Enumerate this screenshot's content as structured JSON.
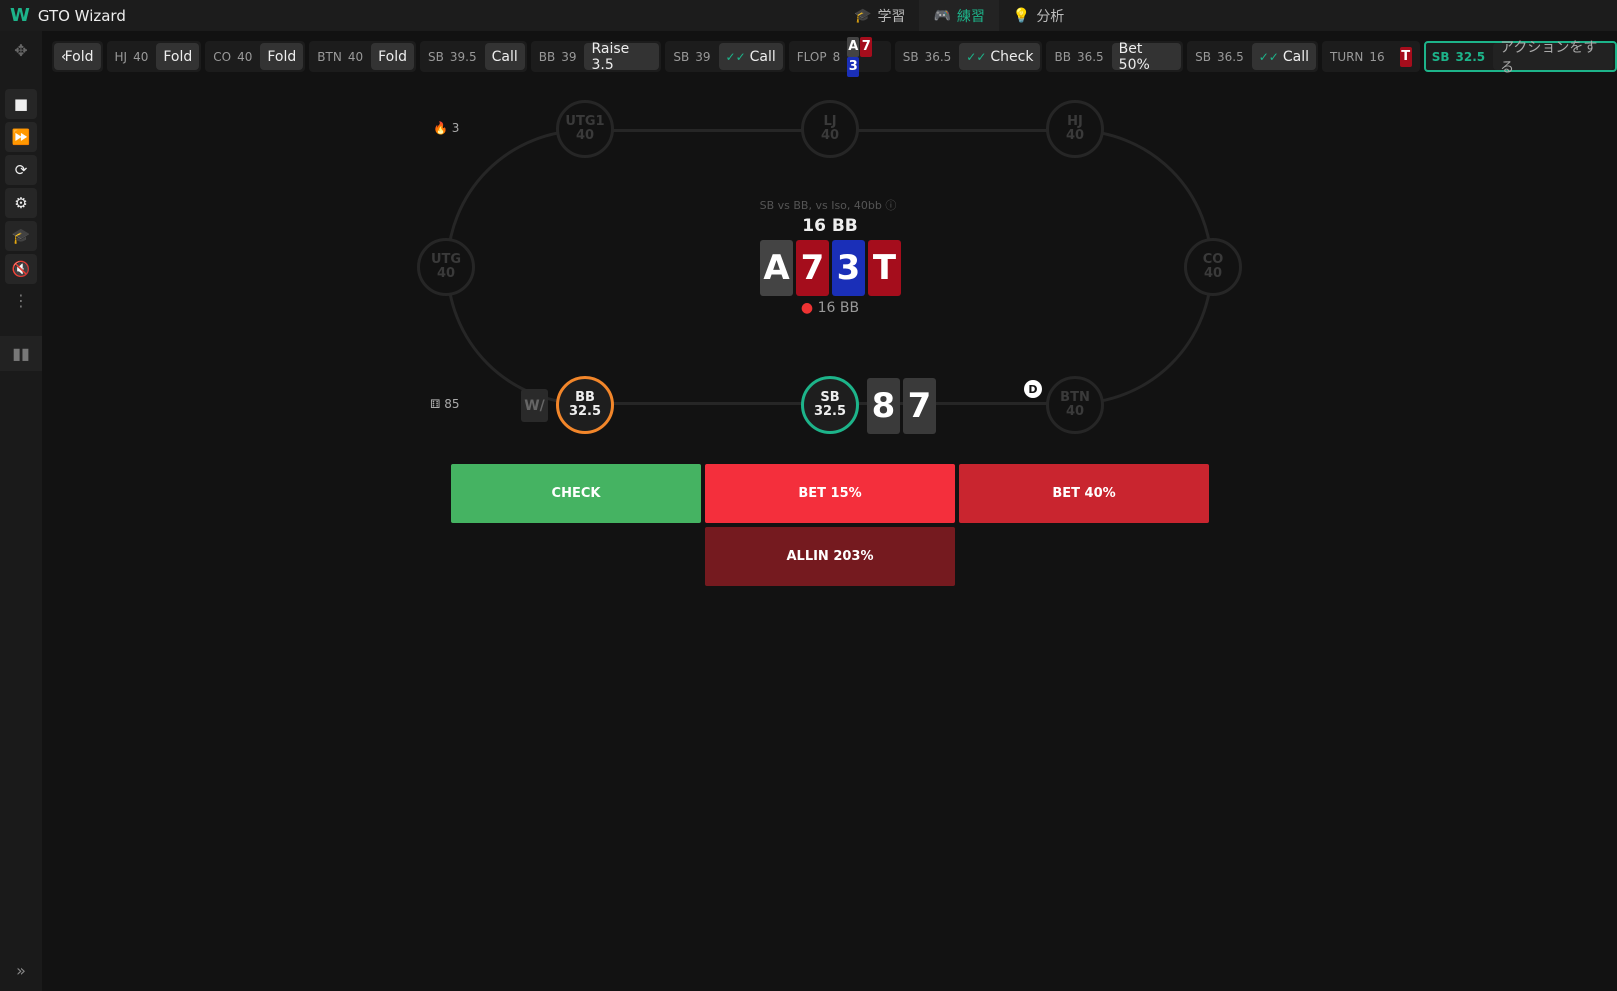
{
  "app": {
    "title": "GTO Wizard"
  },
  "nav": [
    {
      "label": "学習",
      "icon": "graduation-cap-icon"
    },
    {
      "label": "練習",
      "icon": "gamepad-icon",
      "active": true
    },
    {
      "label": "分析",
      "icon": "lightbulb-icon"
    }
  ],
  "sidebar": {
    "icons": [
      "stop-icon",
      "fast-forward-icon",
      "refresh-icon",
      "gear-icon",
      "graduation-cap-icon",
      "mute-icon",
      "more-vertical-icon",
      "bar-chart-icon",
      "expand-icon"
    ]
  },
  "actions": [
    {
      "pos": "",
      "stack": "",
      "action": "Fold"
    },
    {
      "pos": "HJ",
      "stack": "40",
      "action": "Fold"
    },
    {
      "pos": "CO",
      "stack": "40",
      "action": "Fold"
    },
    {
      "pos": "BTN",
      "stack": "40",
      "action": "Fold"
    },
    {
      "pos": "SB",
      "stack": "39.5",
      "action": "Call"
    },
    {
      "pos": "BB",
      "stack": "39",
      "action": "Raise 3.5"
    },
    {
      "pos": "SB",
      "stack": "39",
      "action": "Call",
      "check": true
    },
    {
      "pos": "SB",
      "stack": "36.5",
      "action": "Check",
      "check": true
    },
    {
      "pos": "BB",
      "stack": "36.5",
      "action": "Bet 50%"
    },
    {
      "pos": "SB",
      "stack": "36.5",
      "action": "Call",
      "check": true
    }
  ],
  "flop": {
    "label": "FLOP",
    "pot": "8",
    "cards": [
      "A",
      "7",
      "3"
    ]
  },
  "turn": {
    "label": "TURN",
    "pot": "16",
    "card": "T"
  },
  "current": {
    "pos": "SB",
    "stack": "32.5",
    "prompt": "アクションをする"
  },
  "table": {
    "title": "SB vs BB, vs Iso, 40bb",
    "pot": "16 BB",
    "pot_chips": "16 BB",
    "board": [
      {
        "rank": "A",
        "color": "#444444"
      },
      {
        "rank": "7",
        "color": "#a50d1c"
      },
      {
        "rank": "3",
        "color": "#1a2fb8"
      },
      {
        "rank": "T",
        "color": "#a50d1c"
      }
    ],
    "hero_cards": [
      "8",
      "7"
    ],
    "streak": "3",
    "hands": "85",
    "dealer": "D",
    "seats": {
      "utg1": {
        "name": "UTG1",
        "stack": "40"
      },
      "lj": {
        "name": "LJ",
        "stack": "40"
      },
      "hj": {
        "name": "HJ",
        "stack": "40"
      },
      "utg": {
        "name": "UTG",
        "stack": "40"
      },
      "co": {
        "name": "CO",
        "stack": "40"
      },
      "bb": {
        "name": "BB",
        "stack": "32.5"
      },
      "sb": {
        "name": "SB",
        "stack": "32.5"
      },
      "btn": {
        "name": "BTN",
        "stack": "40"
      }
    }
  },
  "buttons": [
    {
      "label": "CHECK",
      "color": "#45b362"
    },
    {
      "label": "BET 15%",
      "color": "#f42f3c"
    },
    {
      "label": "BET 40%",
      "color": "#c9252f"
    },
    {
      "label": "ALLIN 203%",
      "color": "#751a1f"
    }
  ],
  "colors": {
    "accent": "#1db48a",
    "bb_ring": "#f2862a"
  }
}
